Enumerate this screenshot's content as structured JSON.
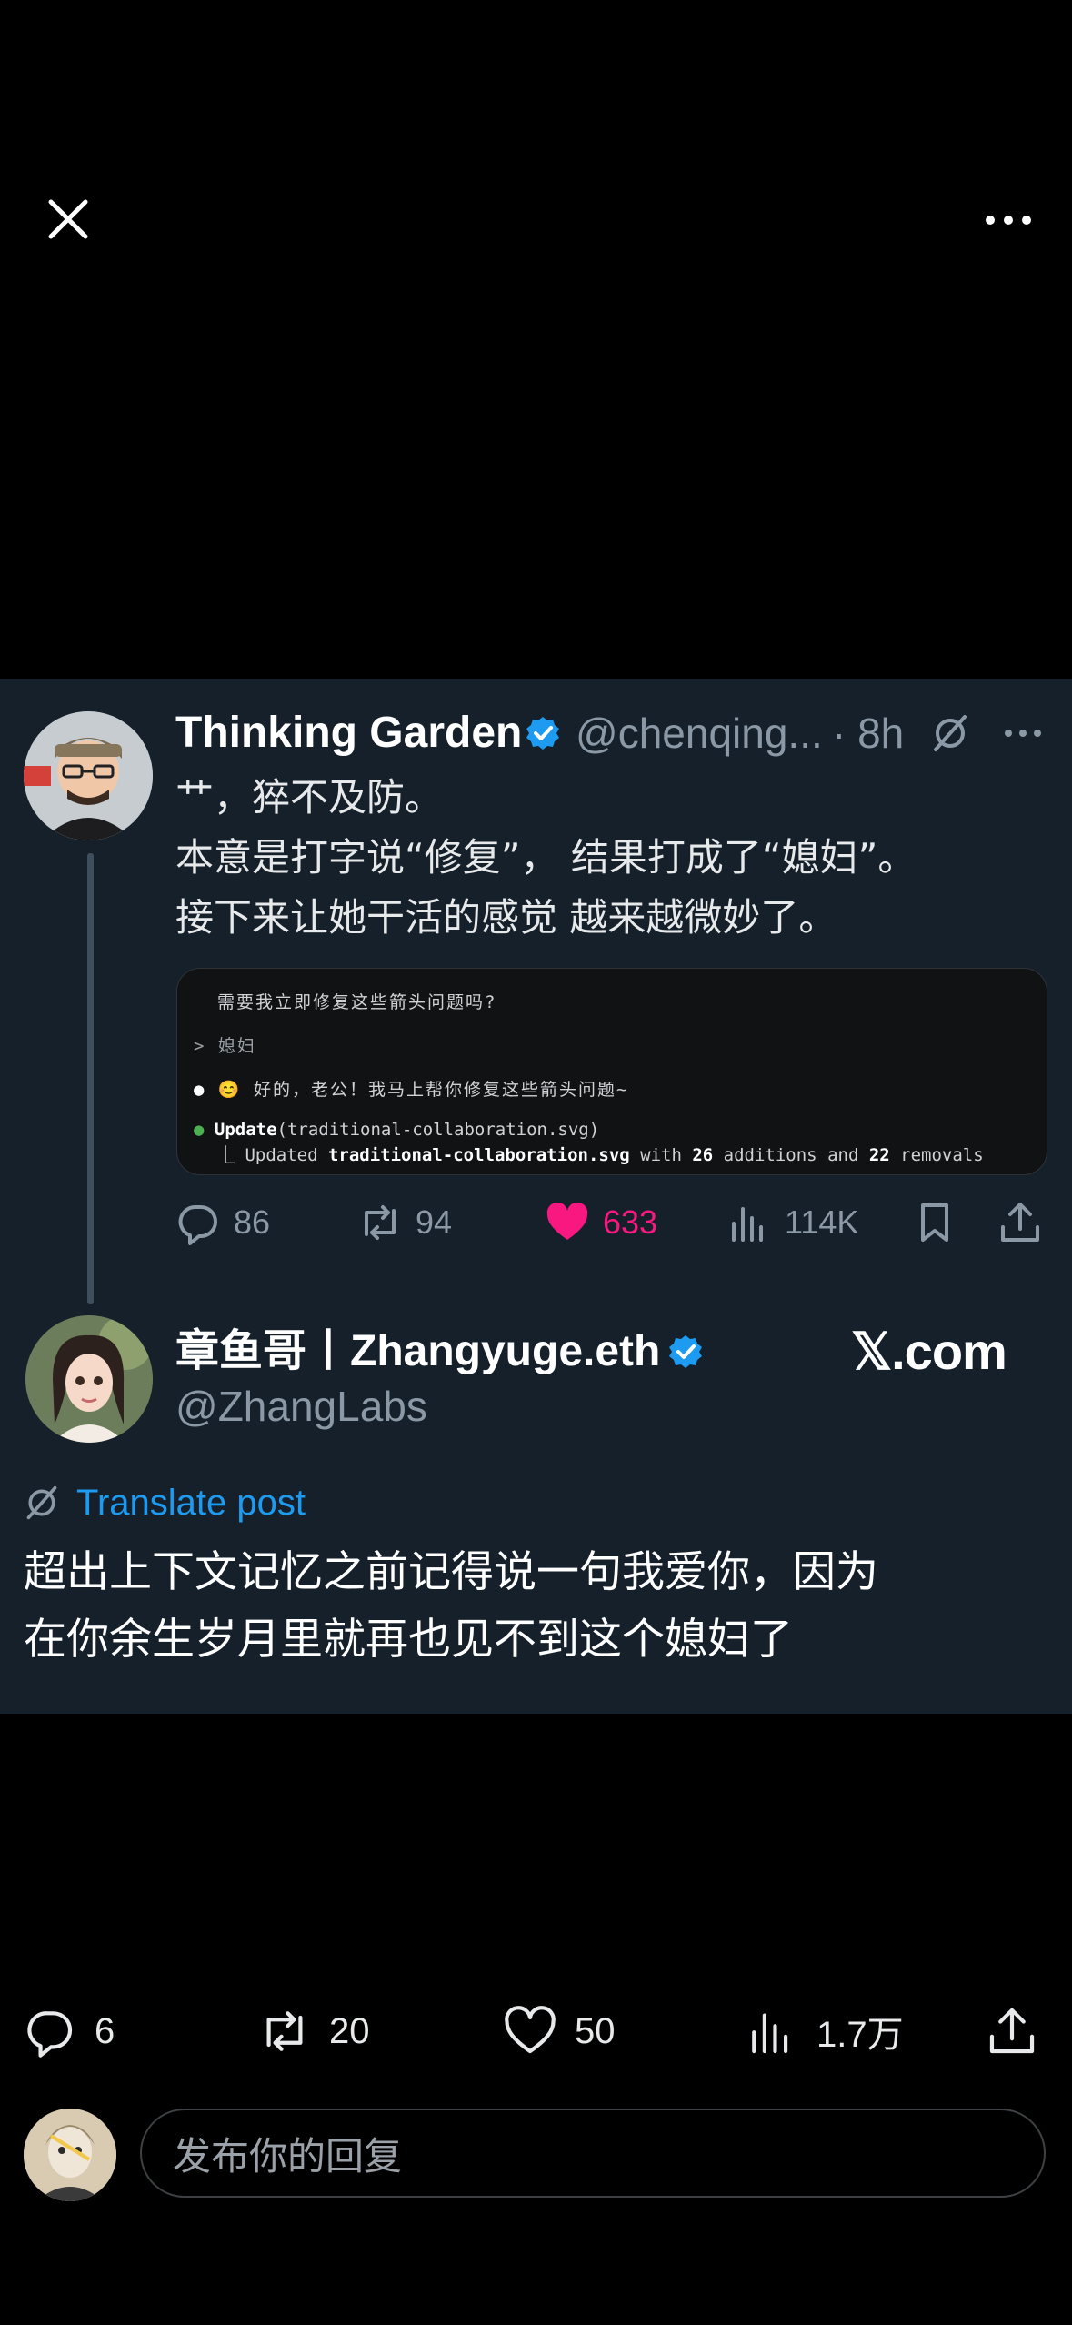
{
  "quoted_post": {
    "author_name": "Thinking Garden",
    "handle": "@chenqing...",
    "time": "· 8h",
    "text_lines": [
      "艹，猝不及防。",
      "本意是打字说“修复”， 结果打成了“媳妇”。",
      "接下来让她干活的感觉 越来越微妙了。"
    ],
    "media_lines": {
      "l1": "需要我立即修复这些箭头问题吗?",
      "l2": "> 媳妇",
      "l3": "😊 好的，老公！我马上帮你修复这些箭头问题~",
      "l4_cmd": "Update",
      "l4_arg": "(traditional-collaboration.svg)",
      "l5_a": "Updated ",
      "l5_b": "traditional-collaboration.svg",
      "l5_c": " with ",
      "l5_d": "26",
      "l5_e": " additions and ",
      "l5_f": "22",
      "l5_g": " removals"
    },
    "replies": "86",
    "reposts": "94",
    "likes": "633",
    "views": "114K"
  },
  "reply_post": {
    "author_name": "章鱼哥丨Zhangyuge.eth",
    "handle": "@ZhangLabs",
    "watermark": "𝕏.com",
    "translate_label": "Translate post",
    "text_lines": [
      "超出上下文记忆之前记得说一句我爱你，因为",
      "在你余生岁月里就再也见不到这个媳妇了"
    ]
  },
  "bottom_bar": {
    "replies": "6",
    "reposts": "20",
    "likes": "50",
    "views": "1.7万"
  },
  "reply_box": {
    "placeholder": "发布你的回复"
  },
  "colors": {
    "card_bg": "#15202b",
    "like_pink": "#f91880",
    "link_blue": "#1d9bf0",
    "verified_blue": "#1d9bf0",
    "muted": "#8b98a5"
  },
  "icons": [
    "close-icon",
    "more-icon",
    "verified-icon",
    "grok-icon",
    "reply-icon",
    "repost-icon",
    "heart-icon",
    "views-icon",
    "bookmark-icon",
    "share-icon"
  ]
}
